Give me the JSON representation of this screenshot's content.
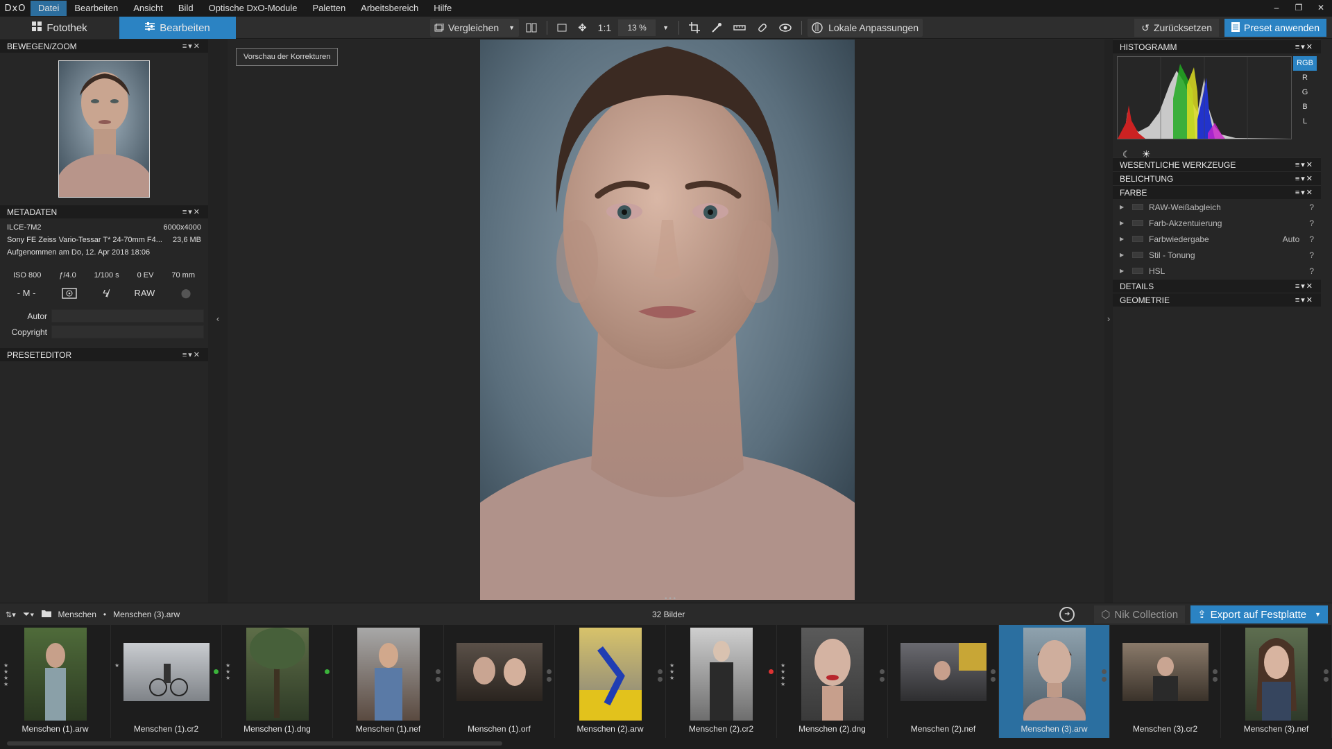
{
  "app": {
    "logo": "DxO"
  },
  "menu": [
    "Datei",
    "Bearbeiten",
    "Ansicht",
    "Bild",
    "Optische DxO-Module",
    "Paletten",
    "Arbeitsbereich",
    "Hilfe"
  ],
  "window_controls": [
    "–",
    "❐",
    "✕"
  ],
  "tabs": {
    "library": "Fotothek",
    "edit": "Bearbeiten"
  },
  "toolbar": {
    "compare": "Vergleichen",
    "one_to_one": "1:1",
    "zoom": "13 %",
    "local_adjust": "Lokale Anpassungen",
    "reset": "Zurücksetzen",
    "apply_preset": "Preset anwenden"
  },
  "left": {
    "move_zoom": "BEWEGEN/ZOOM",
    "metadata": "METADATEN",
    "camera": "ILCE-7M2",
    "resolution": "6000x4000",
    "lens": "Sony FE Zeiss Vario-Tessar T* 24-70mm F4...",
    "filesize": "23,6 MB",
    "taken": "Aufgenommen am Do, 12. Apr 2018 18:06",
    "iso": "ISO 800",
    "aperture": "ƒ/4.0",
    "shutter": "1/100 s",
    "ev": "0 EV",
    "focal": "70 mm",
    "mode": "- M -",
    "format": "RAW",
    "author_label": "Autor",
    "copyright_label": "Copyright",
    "preset_editor": "PRESETEDITOR"
  },
  "viewer": {
    "preview_button": "Vorschau der Korrekturen"
  },
  "right": {
    "histogram": "HISTOGRAMM",
    "channels": [
      "RGB",
      "R",
      "G",
      "B",
      "L"
    ],
    "sections": {
      "essential": "WESENTLICHE WERKZEUGE",
      "exposure": "BELICHTUNG",
      "color": "FARBE",
      "details": "DETAILS",
      "geometry": "GEOMETRIE"
    },
    "color_tools": [
      {
        "name": "RAW-Weißabgleich",
        "value": ""
      },
      {
        "name": "Farb-Akzentuierung",
        "value": ""
      },
      {
        "name": "Farbwiedergabe",
        "value": "Auto"
      },
      {
        "name": "Stil - Tonung",
        "value": ""
      },
      {
        "name": "HSL",
        "value": ""
      }
    ],
    "help": "?"
  },
  "stripbar": {
    "folder": "Menschen",
    "separator": "•",
    "file": "Menschen (3).arw",
    "count": "32 Bilder",
    "nik": "Nik Collection",
    "export": "Export auf Festplatte"
  },
  "film": [
    "Menschen (1).arw",
    "Menschen (1).cr2",
    "Menschen (1).dng",
    "Menschen (1).nef",
    "Menschen (1).orf",
    "Menschen (2).arw",
    "Menschen (2).cr2",
    "Menschen (2).dng",
    "Menschen (2).nef",
    "Menschen (3).arw",
    "Menschen (3).cr2",
    "Menschen (3).nef"
  ],
  "colors": {
    "accent": "#2b83c3",
    "selected_cell": "#2b6fa0"
  }
}
